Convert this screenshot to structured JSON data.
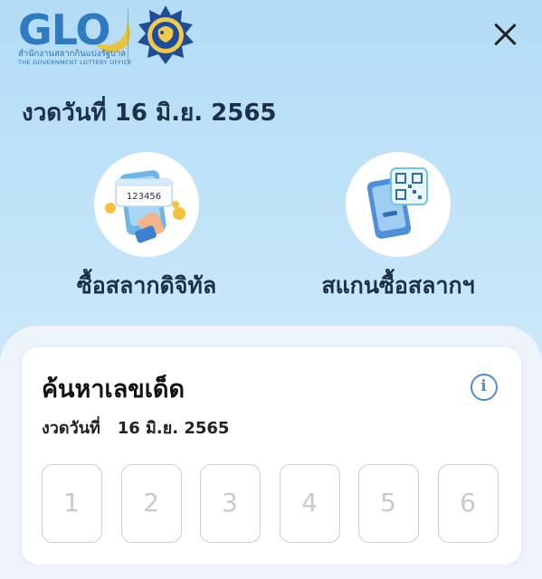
{
  "header": {
    "logo_text": "GLO",
    "logo_thai": "สำนักงานสลากกินแบ่งรัฐบาล",
    "logo_english": "THE GOVERNMENT LOTTERY OFFICE",
    "close_icon": "close-icon"
  },
  "draw": {
    "label": "งวดวันที่ 16 มิ.ย. 2565"
  },
  "actions": {
    "buy_label": "ซื้อสลากดิจิทัล",
    "buy_ticket_number": "123456",
    "buy_icon": "phone-ticket-icon",
    "scan_label": "สแกนซื้อสลากฯ",
    "scan_icon": "qr-scan-icon"
  },
  "search_card": {
    "title": "ค้นหาเลขเด็ด",
    "date_prefix": "งวดวันที่",
    "date_value": "16 มิ.ย. 2565",
    "info_icon": "info-icon",
    "digit_placeholders": [
      "1",
      "2",
      "3",
      "4",
      "5",
      "6"
    ]
  },
  "colors": {
    "background_top": "#b3dcf7",
    "accent_blue": "#2f7bc2",
    "moon_yellow": "#e8c43c",
    "info_blue": "#4a8ed1"
  }
}
